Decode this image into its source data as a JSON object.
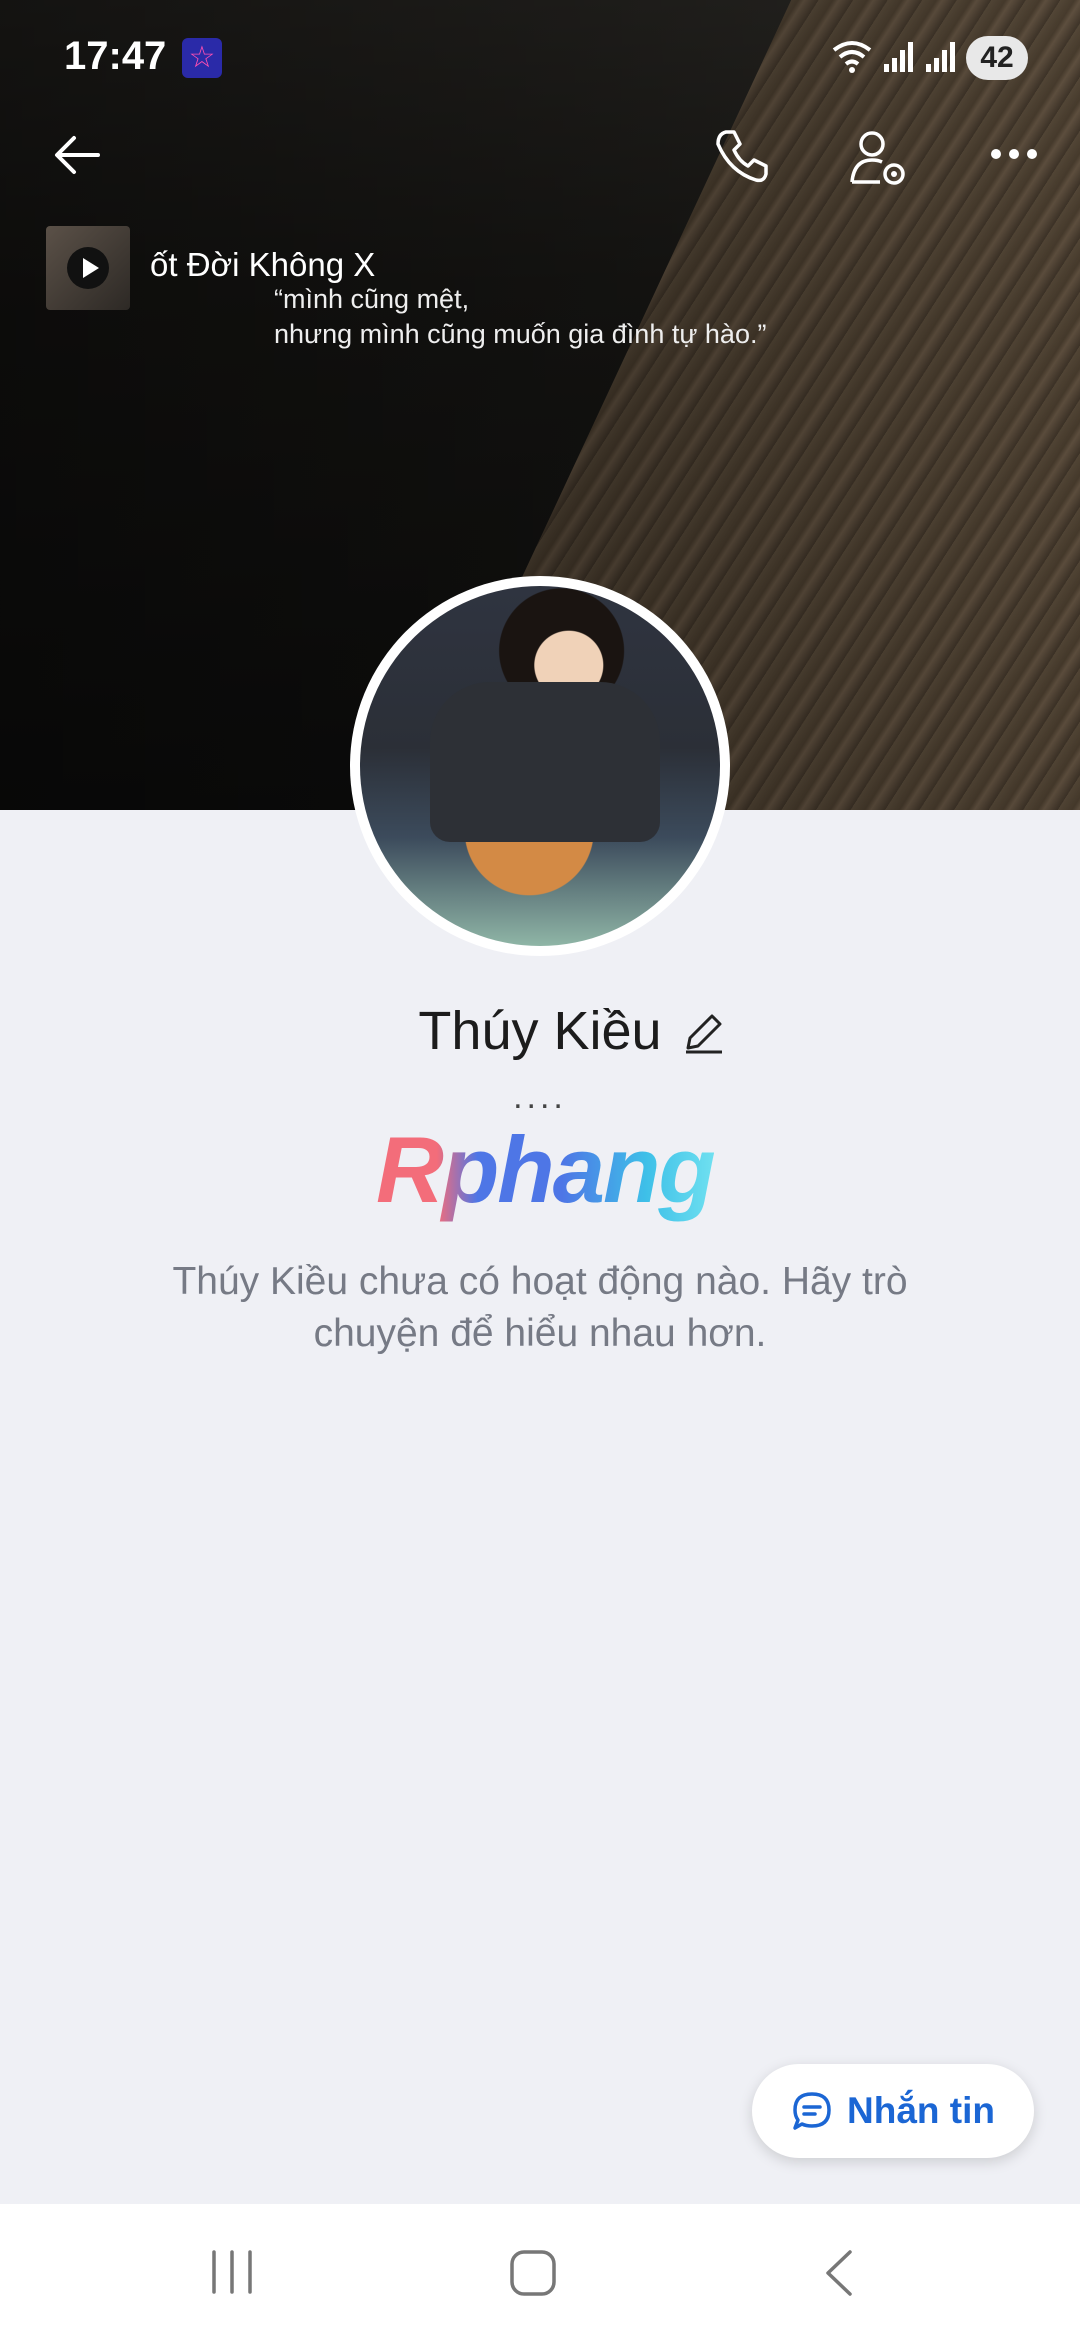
{
  "status_bar": {
    "time": "17:47",
    "app_badge": "☆",
    "battery": "42"
  },
  "header": {
    "music": {
      "song_title": "ốt Đời Không X"
    },
    "cover_quote": [
      "“mình cũng mệt,",
      "nhưng mình cũng muốn gia đình tự hào.”"
    ]
  },
  "profile": {
    "name": "Thúy Kiều",
    "bio": "....",
    "watermark": "Rphang",
    "empty_state": "Thúy Kiều chưa có hoạt động nào. Hãy trò chuyện để hiểu nhau hơn."
  },
  "actions": {
    "message_label": "Nhắn tin"
  },
  "colors": {
    "accent": "#1b66d4",
    "background": "#eff0f5"
  }
}
